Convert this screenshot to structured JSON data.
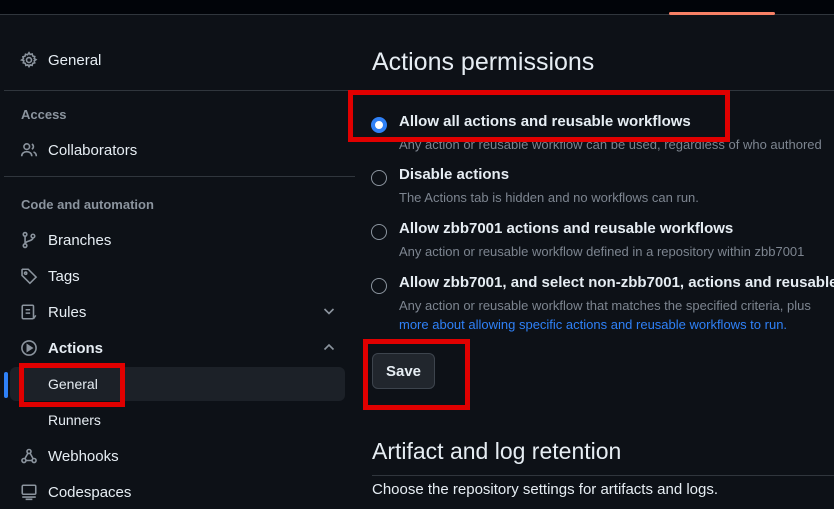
{
  "sidebar": {
    "general": "General",
    "access_section": "Access",
    "collaborators": "Collaborators",
    "code_section": "Code and automation",
    "branches": "Branches",
    "tags": "Tags",
    "rules": "Rules",
    "actions": "Actions",
    "actions_general": "General",
    "actions_runners": "Runners",
    "webhooks": "Webhooks",
    "codespaces": "Codespaces"
  },
  "main": {
    "permissions_title": "Actions permissions",
    "options": [
      {
        "label": "Allow all actions and reusable workflows",
        "desc": "Any action or reusable workflow can be used, regardless of who authored",
        "checked": true
      },
      {
        "label": "Disable actions",
        "desc": "The Actions tab is hidden and no workflows can run.",
        "checked": false
      },
      {
        "label": "Allow zbb7001 actions and reusable workflows",
        "desc": "Any action or reusable workflow defined in a repository within zbb7001",
        "checked": false
      },
      {
        "label": "Allow zbb7001, and select non-zbb7001, actions and reusable",
        "desc": "Any action or reusable workflow that matches the specified criteria, plus",
        "desc_link": "more about allowing specific actions and reusable workflows to run.",
        "checked": false
      }
    ],
    "save_label": "Save",
    "retention_title": "Artifact and log retention",
    "retention_desc": "Choose the repository settings for artifacts and logs."
  },
  "colors": {
    "background": "#0d1117",
    "accent_blue": "#2f81f7",
    "annotation_red": "#e00000"
  }
}
